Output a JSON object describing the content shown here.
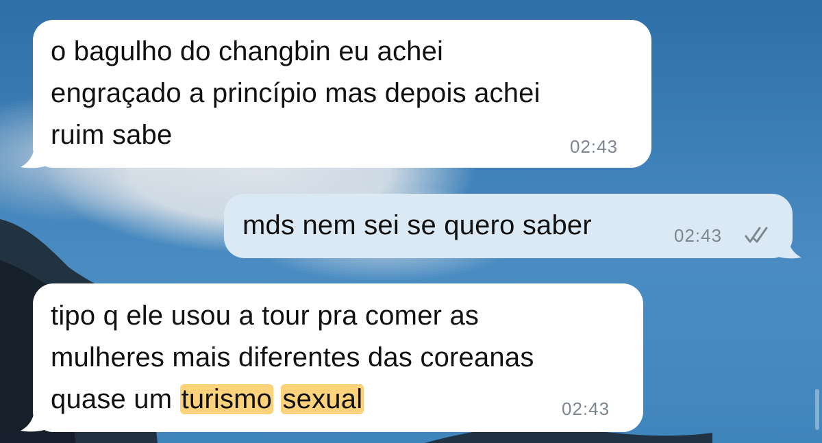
{
  "conversation": {
    "messages": [
      {
        "direction": "incoming",
        "lines": [
          "o bagulho do changbin eu achei",
          "engraçado a princípio mas depois achei",
          "ruim sabe"
        ],
        "time": "02:43"
      },
      {
        "direction": "outgoing",
        "lines": [
          "mds nem sei se quero saber"
        ],
        "time": "02:43",
        "status": "read"
      },
      {
        "direction": "incoming",
        "line1": "tipo q ele usou a tour pra comer as",
        "line2": "mulheres mais diferentes das coreanas",
        "line3_prefix": "quase um ",
        "highlight_1": "turismo",
        "highlight_2": "sexual",
        "time": "02:43"
      }
    ]
  },
  "icons": {
    "read_receipt": "double-check-icon"
  },
  "colors": {
    "incoming_bubble": "#ffffff",
    "outgoing_bubble": "#dbe9f4",
    "highlight": "#fcd27a",
    "timestamp": "#7d8590"
  }
}
